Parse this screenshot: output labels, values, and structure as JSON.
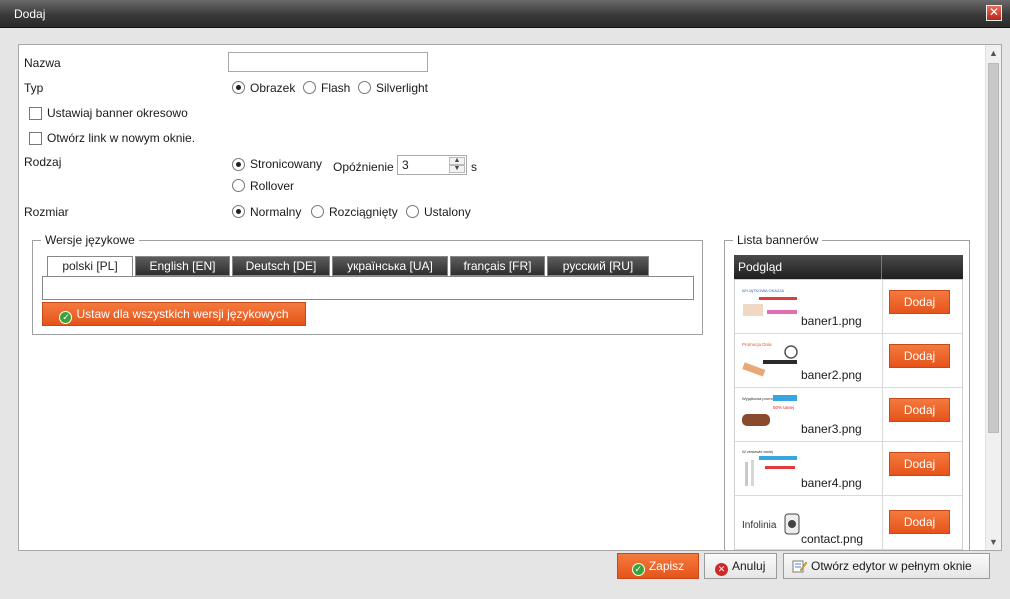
{
  "window": {
    "title": "Dodaj"
  },
  "form": {
    "name_label": "Nazwa",
    "name_value": "",
    "type_label": "Typ",
    "type_options": [
      "Obrazek",
      "Flash",
      "Silverlight"
    ],
    "periodic_label": "Ustawiaj banner okresowo",
    "new_window_label": "Otwórz link w nowym oknie.",
    "kind_label": "Rodzaj",
    "kind_options": [
      "Stronicowany",
      "Rollover"
    ],
    "delay_label": "Opóźnienie",
    "delay_value": "3",
    "delay_unit": "s",
    "size_label": "Rozmiar",
    "size_options": [
      "Normalny",
      "Rozciągnięty",
      "Ustalony"
    ]
  },
  "languages": {
    "legend": "Wersje językowe",
    "tabs": [
      "polski [PL]",
      "English [EN]",
      "Deutsch [DE]",
      "українська [UA]",
      "français [FR]",
      "русский [RU]"
    ],
    "apply_all_label": "Ustaw dla wszystkich wersji językowych"
  },
  "banners": {
    "legend": "Lista bannerów",
    "col_preview": "Podgląd",
    "add_label": "Dodaj",
    "rows": [
      {
        "file": "baner1.png",
        "thumb_texts": [
          "WYJĄTKOWA OKAZJA"
        ]
      },
      {
        "file": "baner2.png",
        "thumb_texts": [
          "Promocja Dnia"
        ]
      },
      {
        "file": "baner3.png",
        "thumb_texts": [
          "Wyjątkowa promocja",
          "50% taniej"
        ]
      },
      {
        "file": "baner4.png",
        "thumb_texts": [
          "W zestawie taniej"
        ]
      },
      {
        "file": "contact.png",
        "thumb_texts": [
          "Infolinia"
        ]
      }
    ]
  },
  "footer": {
    "save_label": "Zapisz",
    "cancel_label": "Anuluj",
    "fullscreen_label": "Otwórz edytor w pełnym oknie"
  }
}
